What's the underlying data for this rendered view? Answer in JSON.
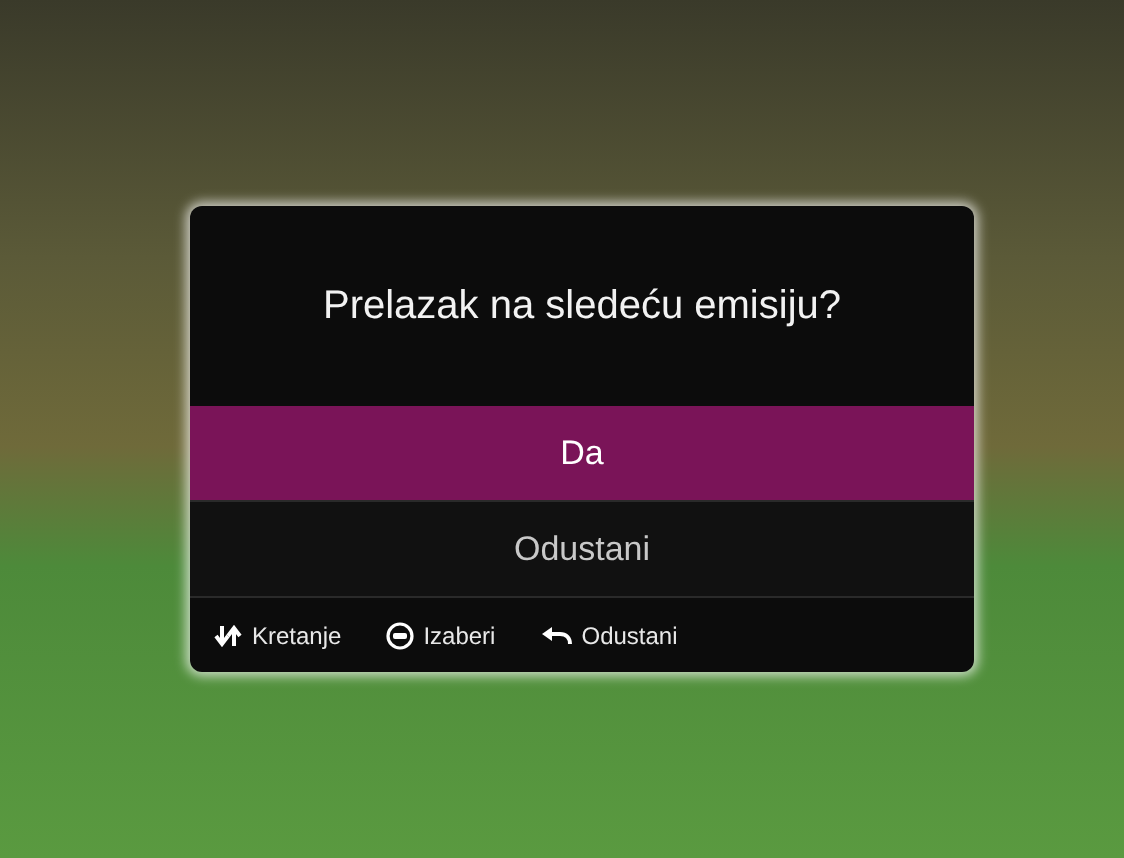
{
  "dialog": {
    "title": "Prelazak na sledeću emisiju?",
    "options": [
      {
        "label": "Da",
        "selected": true
      },
      {
        "label": "Odustani",
        "selected": false
      }
    ],
    "hints": [
      {
        "kind": "navigate",
        "label": "Kretanje"
      },
      {
        "kind": "ok",
        "label": "Izaberi"
      },
      {
        "kind": "back",
        "label": "Odustani"
      }
    ]
  }
}
